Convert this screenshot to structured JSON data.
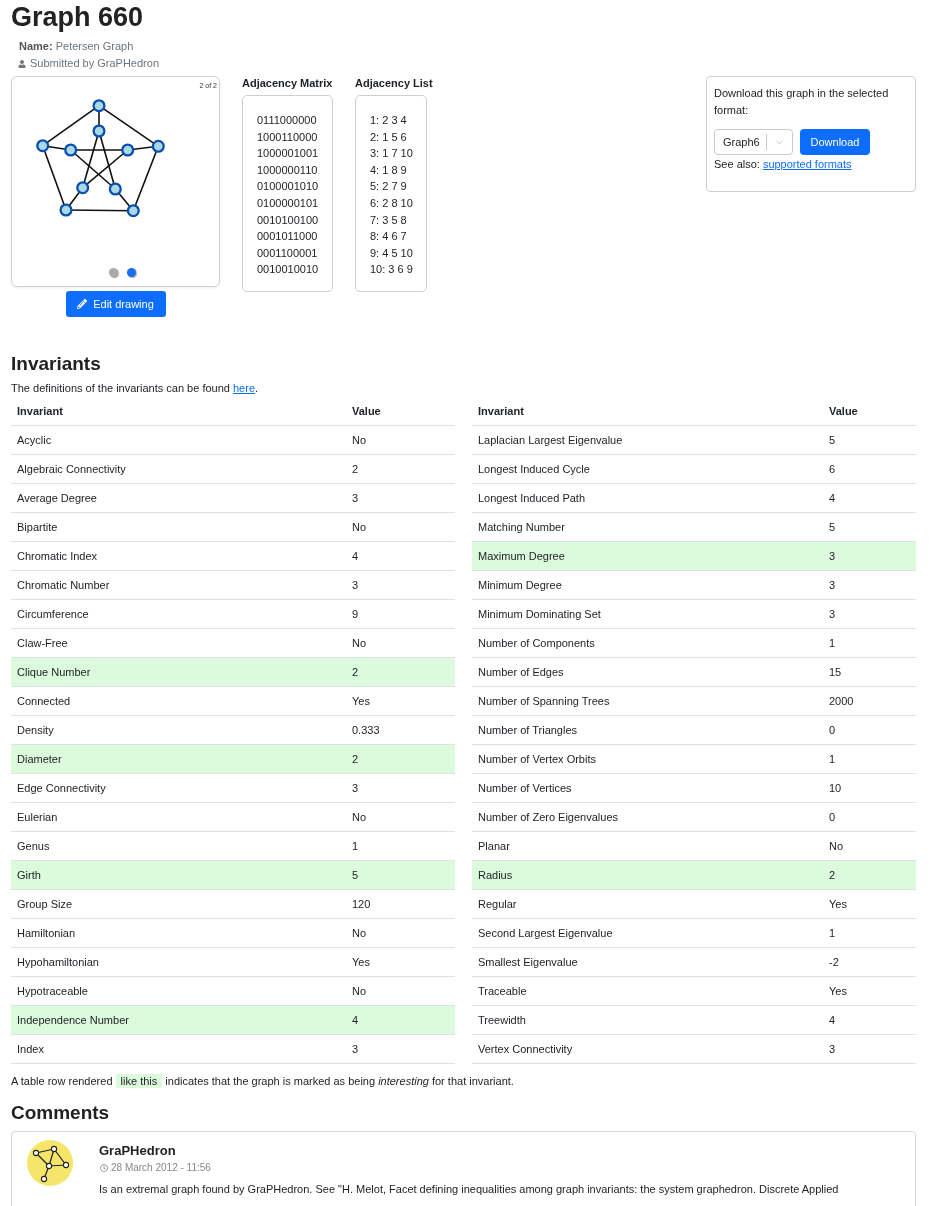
{
  "page": {
    "title": "Graph 660"
  },
  "graph_info": {
    "name_label": "Name:",
    "name": "Petersen Graph",
    "submitted": "Submitted by GraPHedron"
  },
  "drawing": {
    "counter": "2 of 2",
    "slides": [
      {
        "selected": false
      },
      {
        "selected": true
      }
    ],
    "edit_button": "Edit drawing"
  },
  "adjacency_matrix": {
    "title": "Adjacency Matrix",
    "rows": [
      "0111000000",
      "1000110000",
      "1000001001",
      "1000000110",
      "0100001010",
      "0100000101",
      "0010100100",
      "0001011000",
      "0001100001",
      "0010010010"
    ]
  },
  "adjacency_list": {
    "title": "Adjacency List",
    "rows": [
      "1: 2 3 4",
      "2: 1 5 6",
      "3: 1 7 10",
      "4: 1 8 9",
      "5: 2 7 9",
      "6: 2 8 10",
      "7: 3 5 8",
      "8: 4 6 7",
      "9: 4 5 10",
      "10: 3 6 9"
    ]
  },
  "download": {
    "text": "Download this graph in the selected format:",
    "format": "Graph6",
    "button": "Download",
    "see_also": "See also:",
    "link": "supported formats"
  },
  "invariants": {
    "title": "Invariants",
    "intro": "The definitions of the invariants can be found",
    "intro_link": "here",
    "intro_end": ".",
    "tables": [
      {
        "columns": [
          "Invariant",
          "Value"
        ],
        "rows": [
          {
            "invariant": "Acyclic",
            "value": "No",
            "interesting": false
          },
          {
            "invariant": "Algebraic Connectivity",
            "value": "2",
            "interesting": false
          },
          {
            "invariant": "Average Degree",
            "value": "3",
            "interesting": false
          },
          {
            "invariant": "Bipartite",
            "value": "No",
            "interesting": false
          },
          {
            "invariant": "Chromatic Index",
            "value": "4",
            "interesting": false
          },
          {
            "invariant": "Chromatic Number",
            "value": "3",
            "interesting": false
          },
          {
            "invariant": "Circumference",
            "value": "9",
            "interesting": false
          },
          {
            "invariant": "Claw-Free",
            "value": "No",
            "interesting": false
          },
          {
            "invariant": "Clique Number",
            "value": "2",
            "interesting": true
          },
          {
            "invariant": "Connected",
            "value": "Yes",
            "interesting": false
          },
          {
            "invariant": "Density",
            "value": "0.333",
            "interesting": false
          },
          {
            "invariant": "Diameter",
            "value": "2",
            "interesting": true
          },
          {
            "invariant": "Edge Connectivity",
            "value": "3",
            "interesting": false
          },
          {
            "invariant": "Eulerian",
            "value": "No",
            "interesting": false
          },
          {
            "invariant": "Genus",
            "value": "1",
            "interesting": false
          },
          {
            "invariant": "Girth",
            "value": "5",
            "interesting": true
          },
          {
            "invariant": "Group Size",
            "value": "120",
            "interesting": false
          },
          {
            "invariant": "Hamiltonian",
            "value": "No",
            "interesting": false
          },
          {
            "invariant": "Hypohamiltonian",
            "value": "Yes",
            "interesting": false
          },
          {
            "invariant": "Hypotraceable",
            "value": "No",
            "interesting": false
          },
          {
            "invariant": "Independence Number",
            "value": "4",
            "interesting": true
          },
          {
            "invariant": "Index",
            "value": "3",
            "interesting": false
          }
        ]
      },
      {
        "columns": [
          "Invariant",
          "Value"
        ],
        "rows": [
          {
            "invariant": "Laplacian Largest Eigenvalue",
            "value": "5",
            "interesting": false
          },
          {
            "invariant": "Longest Induced Cycle",
            "value": "6",
            "interesting": false
          },
          {
            "invariant": "Longest Induced Path",
            "value": "4",
            "interesting": false
          },
          {
            "invariant": "Matching Number",
            "value": "5",
            "interesting": false
          },
          {
            "invariant": "Maximum Degree",
            "value": "3",
            "interesting": true
          },
          {
            "invariant": "Minimum Degree",
            "value": "3",
            "interesting": false
          },
          {
            "invariant": "Minimum Dominating Set",
            "value": "3",
            "interesting": false
          },
          {
            "invariant": "Number of Components",
            "value": "1",
            "interesting": false
          },
          {
            "invariant": "Number of Edges",
            "value": "15",
            "interesting": false
          },
          {
            "invariant": "Number of Spanning Trees",
            "value": "2000",
            "interesting": false
          },
          {
            "invariant": "Number of Triangles",
            "value": "0",
            "interesting": false
          },
          {
            "invariant": "Number of Vertex Orbits",
            "value": "1",
            "interesting": false
          },
          {
            "invariant": "Number of Vertices",
            "value": "10",
            "interesting": false
          },
          {
            "invariant": "Number of Zero Eigenvalues",
            "value": "0",
            "interesting": false
          },
          {
            "invariant": "Planar",
            "value": "No",
            "interesting": false
          },
          {
            "invariant": "Radius",
            "value": "2",
            "interesting": true
          },
          {
            "invariant": "Regular",
            "value": "Yes",
            "interesting": false
          },
          {
            "invariant": "Second Largest Eigenvalue",
            "value": "1",
            "interesting": false
          },
          {
            "invariant": "Smallest Eigenvalue",
            "value": "-2",
            "interesting": false
          },
          {
            "invariant": "Traceable",
            "value": "Yes",
            "interesting": false
          },
          {
            "invariant": "Treewidth",
            "value": "4",
            "interesting": false
          },
          {
            "invariant": "Vertex Connectivity",
            "value": "3",
            "interesting": false
          }
        ]
      }
    ],
    "footnote": {
      "before": "A table row rendered",
      "sample": "like this",
      "after": "indicates that the graph is marked as being *interesting* for that invariant."
    }
  },
  "comments": {
    "title": "Comments",
    "items": [
      {
        "author": "GraPHedron",
        "date": "28 March 2012 - 11:56",
        "text": "Is an extremal graph found by GraPHedron. See \"H. Melot, Facet defining inequalities among graph invariants: the system graphedron. Discrete Applied"
      }
    ]
  }
}
